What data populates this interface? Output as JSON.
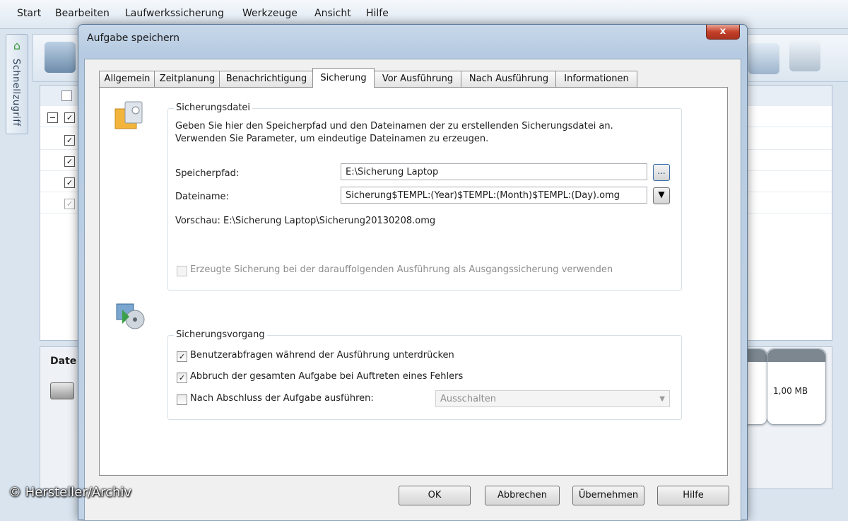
{
  "app": {
    "menu": [
      "Start",
      "Bearbeiten",
      "Laufwerkssicherung",
      "Werkzeuge",
      "Ansicht",
      "Hilfe"
    ],
    "sidebar_tab": "Schnellzugriff",
    "lower_panel_heading": "Date",
    "disk_size": "1,00 MB"
  },
  "dialog": {
    "title": "Aufgabe speichern",
    "close_label": "x",
    "tabs": [
      "Allgemein",
      "Zeitplanung",
      "Benachrichtigung",
      "Sicherung",
      "Vor Ausführung",
      "Nach Ausführung",
      "Informationen"
    ],
    "active_tab": "Sicherung",
    "backup_file": {
      "legend": "Sicherungsdatei",
      "description_line1": "Geben Sie hier den Speicherpfad und den Dateinamen der zu erstellenden Sicherungsdatei an.",
      "description_line2": "Verwenden Sie Parameter, um eindeutige Dateinamen zu erzeugen.",
      "path_label": "Speicherpfad:",
      "path_value": "E:\\Sicherung Laptop",
      "browse_label": "...",
      "filename_label": "Dateiname:",
      "filename_value": "Sicherung$TEMPL:(Year)$TEMPL:(Month)$TEMPL:(Day).omg",
      "preview": "Vorschau: E:\\Sicherung Laptop\\Sicherung20130208.omg",
      "use_as_base_label": "Erzeugte Sicherung bei der darauffolgenden Ausführung als Ausgangssicherung verwenden",
      "use_as_base_checked": false
    },
    "backup_process": {
      "legend": "Sicherungsvorgang",
      "suppress_prompts_label": "Benutzerabfragen während der Ausführung unterdrücken",
      "suppress_prompts_checked": true,
      "abort_on_error_label": "Abbruch der gesamten Aufgabe bei Auftreten eines Fehlers",
      "abort_on_error_checked": true,
      "after_completion_label": "Nach Abschluss der Aufgabe ausführen:",
      "after_completion_checked": false,
      "after_completion_value": "Ausschalten"
    },
    "buttons": {
      "ok": "OK",
      "cancel": "Abbrechen",
      "apply": "Übernehmen",
      "help": "Hilfe"
    }
  },
  "watermark": "© Hersteller/Archiv"
}
